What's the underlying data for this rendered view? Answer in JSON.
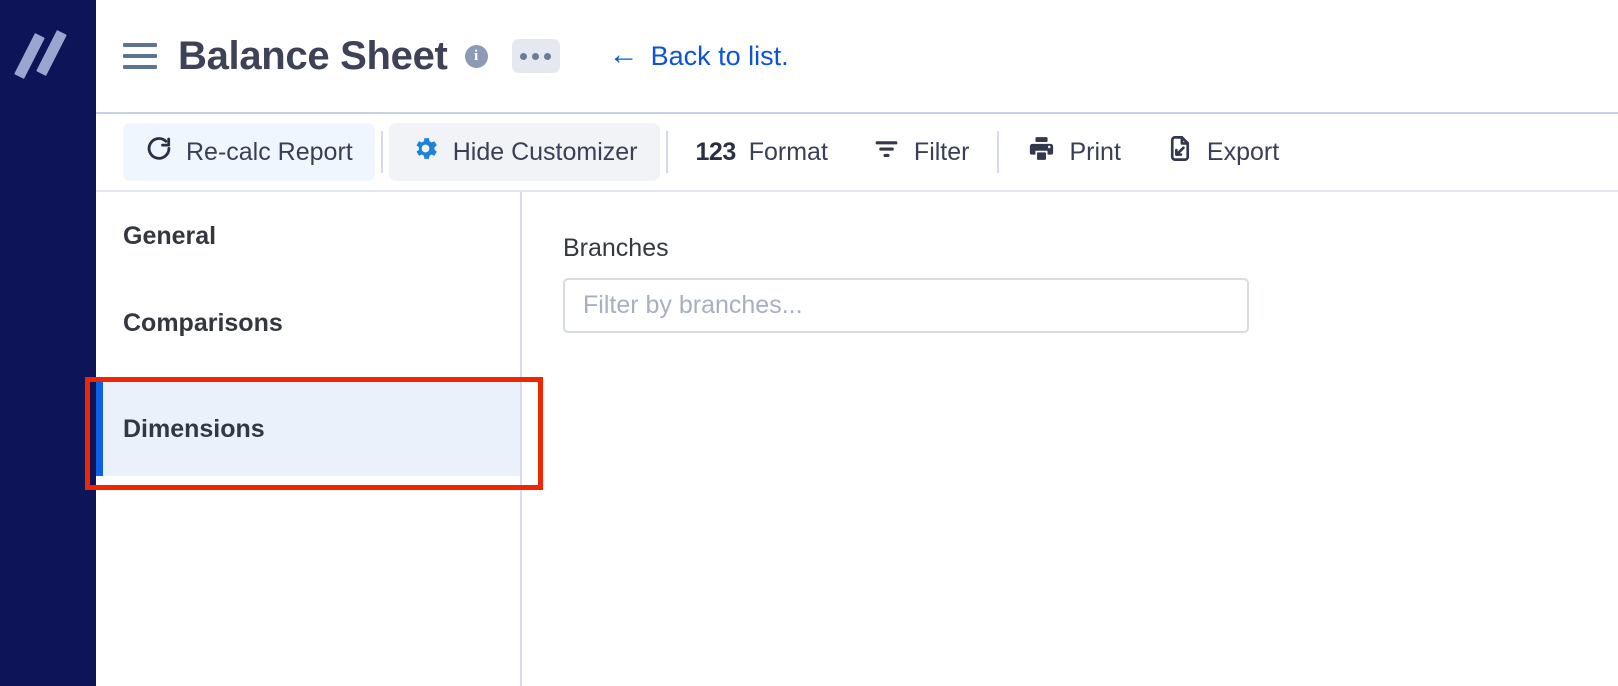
{
  "brand": {
    "logo_icon": "double-slash-logo",
    "rail_color": "#0d1457",
    "logo_color": "#9aa6cf"
  },
  "header": {
    "menu_icon": "hamburger-menu-icon",
    "title": "Balance Sheet",
    "info_icon": "info-circle-icon",
    "info_glyph": "i",
    "more_actions_icon": "ellipsis-icon",
    "back_link": {
      "label": "Back to list.",
      "arrow": "←",
      "color": "#0d53d9"
    }
  },
  "toolbar": {
    "buttons": [
      {
        "label": "Re-calc Report",
        "icon": "refresh-icon",
        "style": "tinted",
        "icon_color": "#2b2f45"
      },
      {
        "label": "Hide Customizer",
        "icon": "gear-icon",
        "style": "greyed",
        "icon_color": "#1f82d6"
      },
      {
        "label": "Format",
        "icon": "123-icon",
        "style": "plain",
        "icon_text": "123"
      },
      {
        "label": "Filter",
        "icon": "filter-icon",
        "style": "plain",
        "icon_color": "#33384d"
      },
      {
        "label": "Print",
        "icon": "printer-icon",
        "style": "plain",
        "icon_color": "#33384d"
      },
      {
        "label": "Export",
        "icon": "export-icon",
        "style": "plain",
        "icon_color": "#33384d"
      }
    ]
  },
  "customizer": {
    "nav_items": [
      {
        "label": "General",
        "active": false
      },
      {
        "label": "Comparisons",
        "active": false
      },
      {
        "label": "Dimensions",
        "active": true
      }
    ],
    "panel": {
      "branches_label": "Branches",
      "branches_value": "",
      "branches_placeholder": "Filter by branches..."
    }
  },
  "annotation": {
    "highlight_color": "#ef2600",
    "target": "Dimensions"
  }
}
